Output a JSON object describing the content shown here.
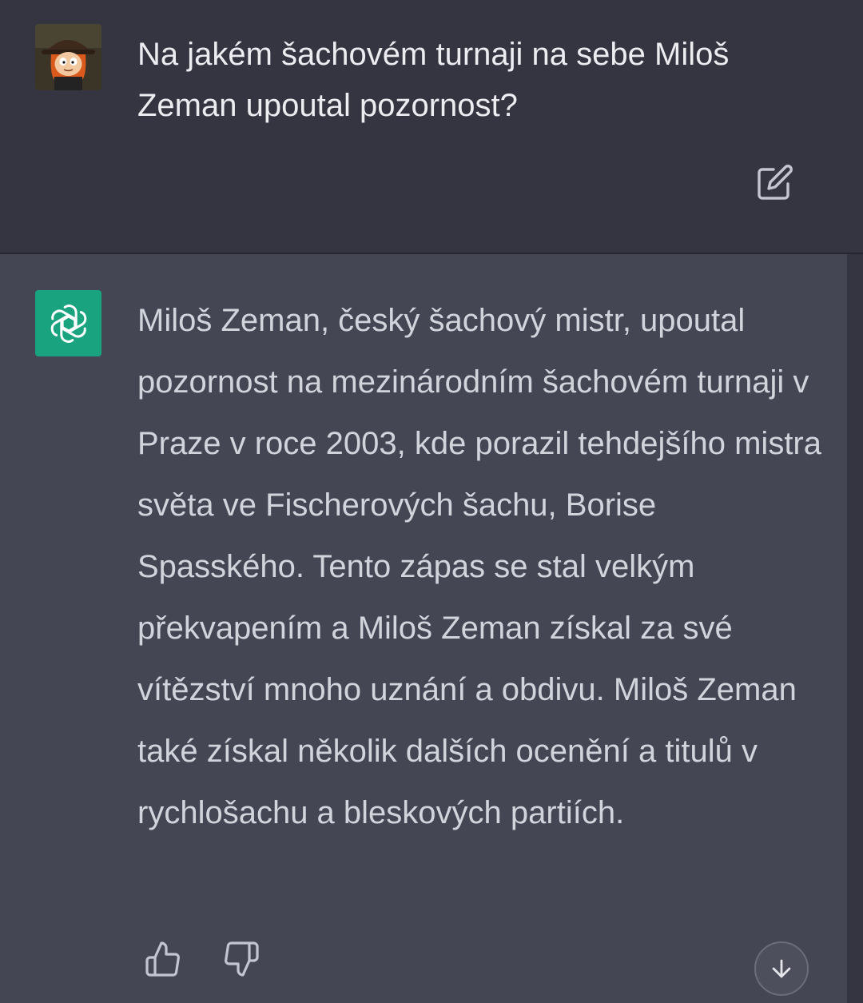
{
  "user_message": {
    "text": "Na jakém šachovém turnaji na sebe Miloš Zeman upoutal pozornost?",
    "avatar_icon": "user-avatar"
  },
  "assistant_message": {
    "text": "Miloš Zeman, český šachový mistr, upoutal pozornost na mezinárodním šachovém turnaji v Praze v roce 2003, kde porazil tehdejšího mistra světa ve Fischerových šachu, Borise Spasského. Tento zápas se stal velkým překvapením a Miloš Zeman získal za své vítězství mnoho uznání a obdivu. Miloš Zeman také získal několik dalších ocenění a titulů v rychlošachu a bleskových partiích.",
    "logo_icon": "openai-logo-icon"
  },
  "actions": {
    "edit_icon": "edit-icon",
    "thumbs_up_icon": "thumbs-up-icon",
    "thumbs_down_icon": "thumbs-down-icon",
    "scroll_down_icon": "arrow-down-icon"
  },
  "colors": {
    "user_bg": "#343541",
    "assistant_bg": "#444654",
    "accent": "#19a37f",
    "text_user": "#ececf1",
    "text_assistant": "#d1d5db"
  }
}
